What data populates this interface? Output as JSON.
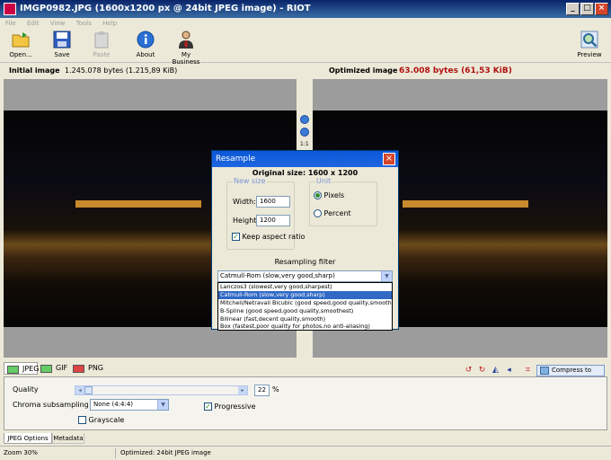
{
  "window": {
    "title": "IMGP0982.JPG (1600x1200 px @ 24bit JPEG image) - RIOT",
    "minimize": "_",
    "maximize": "□",
    "close": "×"
  },
  "menu": [
    "File",
    "Edit",
    "View",
    "Tools",
    "Help"
  ],
  "toolbar": {
    "open": "Open...",
    "save": "Save",
    "paste": "Paste",
    "about": "About",
    "business": "My Business",
    "preview": "Preview"
  },
  "info": {
    "initial_label": "Initial image",
    "initial_value": "1.245.078 bytes (1.215,89 KiB)",
    "optimized_label": "Optimized image",
    "optimized_value": "63.008 bytes (61,53 KiB)",
    "optimized_color": "#b01010"
  },
  "zoom_label": "1:1",
  "dialog": {
    "title": "Resample",
    "close": "×",
    "original_size": "Original size: 1600 x 1200",
    "new_size_legend": "New size",
    "width_label": "Width:",
    "width_value": "1600",
    "height_label": "Height:",
    "height_value": "1200",
    "keep_aspect": "Keep aspect ratio",
    "unit_legend": "Unit",
    "pixels": "Pixels",
    "percent": "Percent",
    "filter_label": "Resampling filter",
    "filter_selected": "Catmull-Rom (slow,very good,sharp)",
    "filter_options": [
      "Lanczos3 (slowest,very good,sharpest)",
      "Catmull-Rom (slow,very good,sharp)",
      "Mitchell/Netravali Bicubic (good speed,good quality,smooth)",
      "B-Spline (good speed,good quality,smoothest)",
      "Bilinear (fast,decent quality,smooth)",
      "Box (fastest,poor quality for photos,no anti-aliasing)"
    ]
  },
  "format_tabs": [
    "JPEG",
    "GIF",
    "PNG"
  ],
  "compress_button": "Compress to size",
  "options": {
    "quality_label": "Quality",
    "quality_value": "22",
    "quality_unit": "%",
    "quality_fraction": 0.22,
    "chroma_label": "Chroma subsampling",
    "chroma_value": "None (4:4:4)",
    "progressive": "Progressive",
    "grayscale": "Grayscale"
  },
  "bottom_tabs": [
    "JPEG Options",
    "Metadata"
  ],
  "status": {
    "zoom": "Zoom 30%",
    "message": "Optimized: 24bit JPEG image"
  }
}
